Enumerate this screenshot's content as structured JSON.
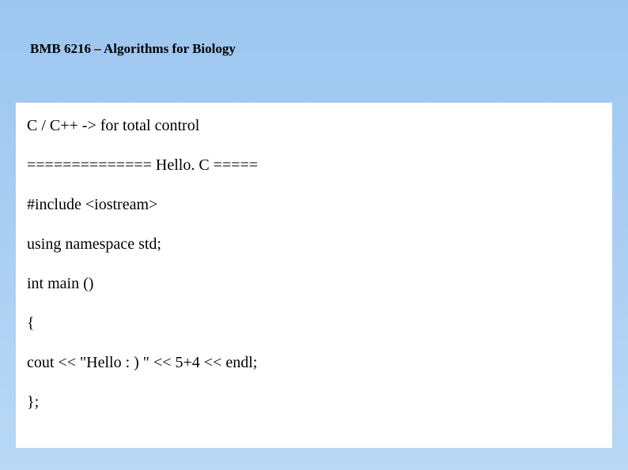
{
  "header": {
    "course_title": "BMB 6216 – Algorithms for Biology"
  },
  "content": {
    "lines": [
      "C / C++ -> for total control",
      "============== Hello. C =====",
      "#include <iostream>",
      "using namespace std;",
      "int main ()",
      "{",
      "cout << \"Hello : ) \" << 5+4 << endl;",
      "};"
    ]
  }
}
